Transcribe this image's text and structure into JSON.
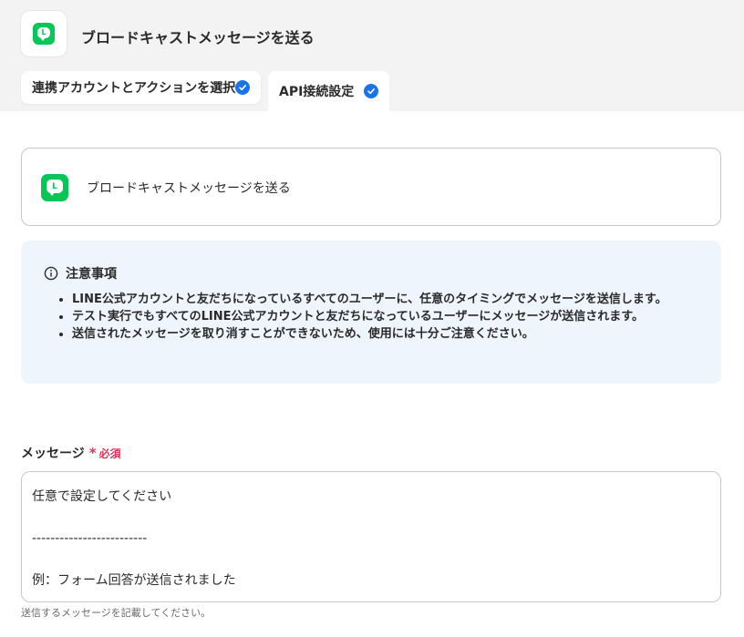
{
  "header": {
    "title": "ブロードキャストメッセージを送る",
    "app_icon": "line-app-icon",
    "brand_color": "#06c755"
  },
  "tabs": [
    {
      "label": "連携アカウントとアクションを選択",
      "status_icon": "check-circle-icon",
      "active": false
    },
    {
      "label": "API接続設定",
      "status_icon": "check-circle-icon",
      "active": true
    }
  ],
  "action_card": {
    "label": "ブロードキャストメッセージを送る",
    "icon": "line-app-icon"
  },
  "notice": {
    "icon": "info-icon",
    "title": "注意事項",
    "items": [
      "LINE公式アカウントと友だちになっているすべてのユーザーに、任意のタイミングでメッセージを送信します。",
      "テスト実行でもすべてのLINE公式アカウントと友だちになっているユーザーにメッセージが送信されます。",
      "送信されたメッセージを取り消すことができないため、使用には十分ご注意ください。"
    ],
    "background": "#eef5fd"
  },
  "message_field": {
    "label": "メッセージ",
    "required_mark": "*",
    "required_text": "必須",
    "value": "任意で設定してください\n\n-------------------------\n\n例：フォーム回答が送信されました",
    "helper": "送信するメッセージを記載してください。"
  },
  "colors": {
    "accent": "#1a73e8",
    "required": "#e5315a"
  }
}
